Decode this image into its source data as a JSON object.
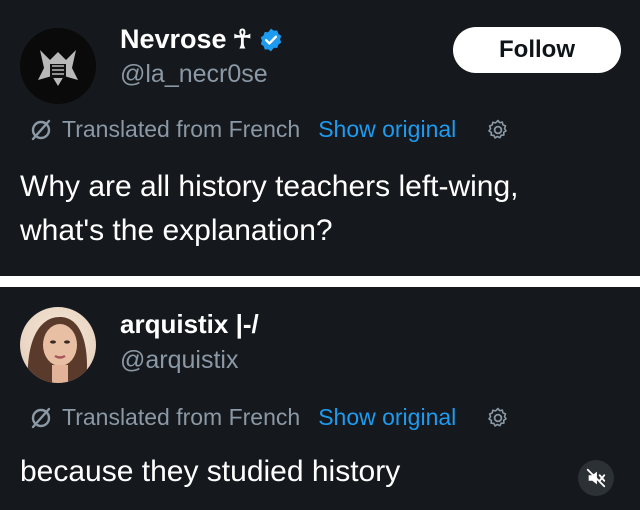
{
  "tweet1": {
    "display_name": "Nevrose",
    "name_symbol": "☥",
    "handle": "@la_necr0se",
    "follow_label": "Follow",
    "translated_label": "Translated from French",
    "show_original_label": "Show original",
    "text_line1": "Why are all history teachers left-wing,",
    "text_line2": "what's the explanation?",
    "verified_color": "#1d9bf0"
  },
  "tweet2": {
    "display_name": "arquistix |-/",
    "handle": "@arquistix",
    "translated_label": "Translated from French",
    "show_original_label": "Show original",
    "text": "because they studied history"
  },
  "icons": {
    "translate": "translate-slash-icon",
    "settings": "gear-icon",
    "mute": "muted-speaker-icon",
    "verified": "verified-badge-icon"
  },
  "colors": {
    "background": "#15181c",
    "link": "#1d9bf0",
    "secondary_text": "#8b98a5"
  }
}
